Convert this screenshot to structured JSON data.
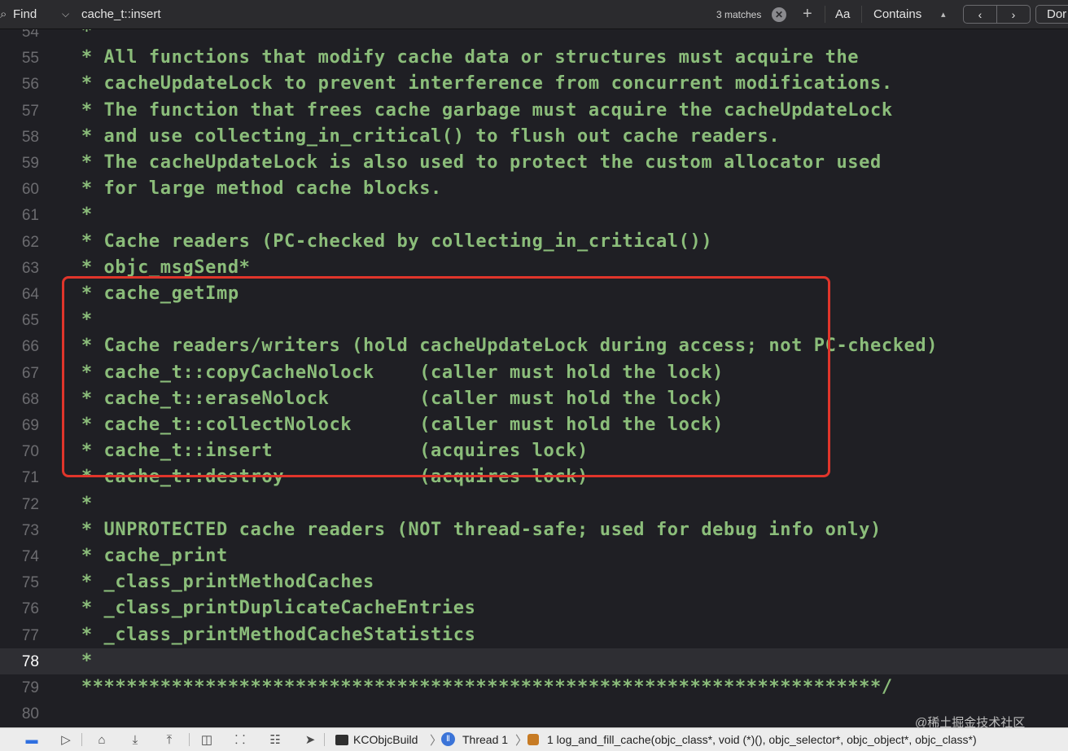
{
  "find_bar": {
    "search_icon": "magnifier-icon",
    "mode": "Find",
    "query": "cache_t::insert",
    "matches": "3 matches",
    "case_toggle": "Aa",
    "match_type": "Contains",
    "prev_icon": "chevron-left-icon",
    "next_icon": "chevron-right-icon",
    "done": "Dor"
  },
  "editor": {
    "current_line": "78",
    "colors": {
      "comment": "#8bbd7a",
      "background": "#1f1f24",
      "highlight_box": "#e0352b"
    },
    "lines": [
      {
        "num": "54",
        "text": " *"
      },
      {
        "num": "55",
        "text": " * All functions that modify cache data or structures must acquire the"
      },
      {
        "num": "56",
        "text": " * cacheUpdateLock to prevent interference from concurrent modifications."
      },
      {
        "num": "57",
        "text": " * The function that frees cache garbage must acquire the cacheUpdateLock"
      },
      {
        "num": "58",
        "text": " * and use collecting_in_critical() to flush out cache readers."
      },
      {
        "num": "59",
        "text": " * The cacheUpdateLock is also used to protect the custom allocator used"
      },
      {
        "num": "60",
        "text": " * for large method cache blocks."
      },
      {
        "num": "61",
        "text": " *"
      },
      {
        "num": "62",
        "text": " * Cache readers (PC-checked by collecting_in_critical())"
      },
      {
        "num": "63",
        "text": " * objc_msgSend*"
      },
      {
        "num": "64",
        "text": " * cache_getImp"
      },
      {
        "num": "65",
        "text": " *"
      },
      {
        "num": "66",
        "text": " * Cache readers/writers (hold cacheUpdateLock during access; not PC-checked)"
      },
      {
        "num": "67",
        "text": " * cache_t::copyCacheNolock    (caller must hold the lock)"
      },
      {
        "num": "68",
        "text": " * cache_t::eraseNolock        (caller must hold the lock)"
      },
      {
        "num": "69",
        "text": " * cache_t::collectNolock      (caller must hold the lock)"
      },
      {
        "num": "70",
        "text": " * cache_t::insert             (acquires lock)"
      },
      {
        "num": "71",
        "text": " * cache_t::destroy            (acquires lock)"
      },
      {
        "num": "72",
        "text": " *"
      },
      {
        "num": "73",
        "text": " * UNPROTECTED cache readers (NOT thread-safe; used for debug info only)"
      },
      {
        "num": "74",
        "text": " * cache_print"
      },
      {
        "num": "75",
        "text": " * _class_printMethodCaches"
      },
      {
        "num": "76",
        "text": " * _class_printDuplicateCacheEntries"
      },
      {
        "num": "77",
        "text": " * _class_printMethodCacheStatistics"
      },
      {
        "num": "78",
        "text": " *"
      },
      {
        "num": "79",
        "text": " ***********************************************************************/"
      },
      {
        "num": "80",
        "text": ""
      }
    ]
  },
  "debug_bar": {
    "buttons": [
      "breakpoint-toggle-icon",
      "continue-icon",
      "step-over-icon",
      "step-into-icon",
      "step-out-icon",
      "view-hierarchy-icon",
      "memory-graph-icon",
      "environment-icon",
      "location-icon"
    ],
    "target": "KCObjcBuild",
    "thread": "Thread 1",
    "frame": "1 log_and_fill_cache(objc_class*, void (*)(), objc_selector*, objc_object*, objc_class*)"
  },
  "watermark": "@稀土掘金技术社区"
}
